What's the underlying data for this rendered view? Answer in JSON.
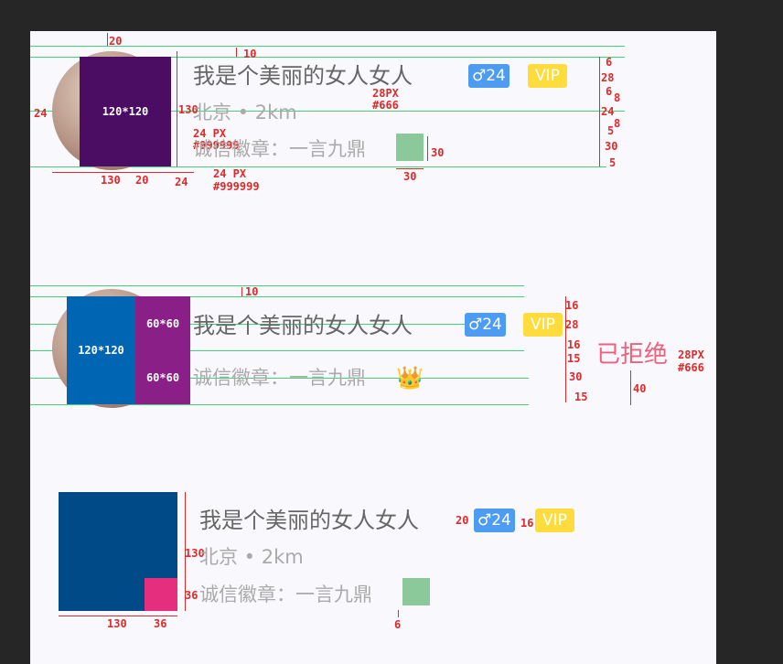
{
  "rows": [
    {
      "name": "我是个美丽的女人女人",
      "gender_badge": "♂24",
      "vip_badge": "VIP",
      "location": "北京 • 2km",
      "badge_text": "诚信徽章：一言九鼎",
      "box_label": "120*120",
      "notes": {
        "top": "20",
        "gap_top": "10",
        "left": "24",
        "height": "130",
        "name_font": "28PX",
        "name_color": "#666",
        "loc_font": "24 PX",
        "loc_color": "#999999",
        "badge_font": "24 PX",
        "badge_color": "#999999",
        "medal_h": "30",
        "medal_w": "30",
        "bottom_w1": "130",
        "bottom_w2": "20",
        "bottom_w3": "24",
        "right": [
          "6",
          "28",
          "6",
          "8",
          "24",
          "8",
          "5",
          "30",
          "5"
        ]
      }
    },
    {
      "name": "我是个美丽的女人女人",
      "gender_badge": "♂24",
      "vip_badge": "VIP",
      "badge_text": "诚信徽章：一言九鼎",
      "box_label": "120*120",
      "small_label_1": "60*60",
      "small_label_2": "60*60",
      "crown": "👑",
      "status": "已拒绝",
      "notes": {
        "gap_top": "10",
        "status_font": "28PX",
        "status_color": "#666",
        "status_h": "40",
        "right": [
          "16",
          "28",
          "16",
          "15",
          "30",
          "15"
        ]
      }
    },
    {
      "name": "我是个美丽的女人女人",
      "gender_badge": "♂24",
      "vip_badge": "VIP",
      "location": "北京 • 2km",
      "badge_text": "诚信徽章：一言九鼎",
      "notes": {
        "height": "130",
        "corner": "36",
        "bottom_w1": "130",
        "bottom_w2": "36",
        "gap_name": "20",
        "gap_badge": "16",
        "medal_gap": "6"
      }
    }
  ],
  "colors": {
    "avatar_box_1": "#4a0d63",
    "avatar_box_2": "#0066b3",
    "small_box": "#8a1f87",
    "avatar_box_3": "#004b87",
    "corner_box": "#e62e7e",
    "medal": "#8bc99a",
    "guide": "#3fd27a",
    "redline": "#e02a2a",
    "status_pink": "#f0607c"
  }
}
